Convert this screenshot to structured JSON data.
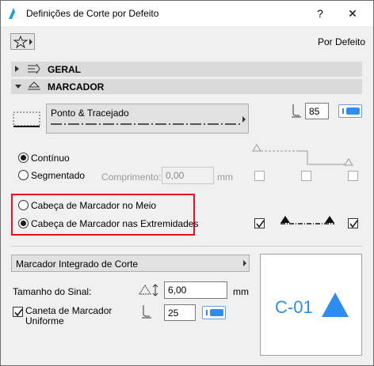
{
  "window": {
    "title": "Definições de Corte por Defeito",
    "help_label": "?",
    "close_label": "✕"
  },
  "toolbar": {
    "favorites_icon": "star-icon",
    "default_label": "Por Defeito"
  },
  "sections": {
    "geral": "GERAL",
    "marcador": "MARCADOR"
  },
  "line": {
    "type_label": "Ponto & Tracejado",
    "pen_value": "85"
  },
  "mode": {
    "continuo": "Contínuo",
    "segmentado": "Segmentado",
    "comprimento_label": "Comprimento:",
    "comprimento_value": "0,00",
    "unit": "mm",
    "selected": "continuo"
  },
  "marker_head": {
    "meio": "Cabeça de Marcador no Meio",
    "extremidades": "Cabeça de Marcador nas Extremidades",
    "selected": "extremidades"
  },
  "bottom": {
    "marker_type": "Marcador Integrado de Corte",
    "size_label": "Tamanho do Sinal:",
    "size_value": "6,00",
    "size_unit": "mm",
    "pen_label_1": "Caneta de Marcador",
    "pen_label_2": "Uniforme",
    "pen_value": "25",
    "pen_checked": true
  },
  "preview": {
    "label": "C-01",
    "accent": "#2f8cf0"
  }
}
